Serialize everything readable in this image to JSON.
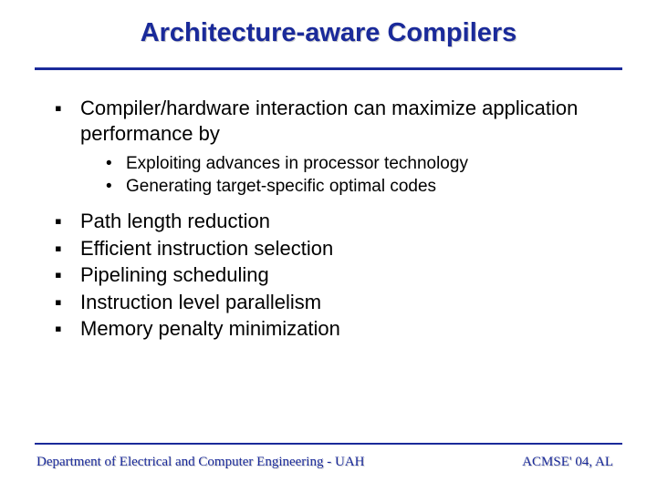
{
  "title": "Architecture-aware Compilers",
  "bullets": {
    "intro": "Compiler/hardware interaction can maximize application performance by",
    "sub": [
      "Exploiting advances in processor technology",
      "Generating target-specific optimal codes"
    ],
    "items": [
      "Path length reduction",
      "Efficient instruction selection",
      "Pipelining scheduling",
      "Instruction level parallelism",
      "Memory penalty minimization"
    ]
  },
  "footer": {
    "left": "Department of Electrical and Computer Engineering - UAH",
    "right": "ACMSE' 04, AL"
  },
  "glyphs": {
    "square": "§",
    "dot": "•"
  }
}
